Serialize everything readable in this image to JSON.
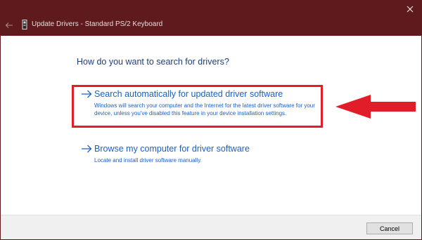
{
  "window": {
    "title": "Update Drivers - Standard PS/2 Keyboard",
    "titlebar_color": "#5e1a1c",
    "close_icon": "close-icon",
    "back_icon": "back-arrow-icon",
    "device_icon": "keyboard-device-icon"
  },
  "main": {
    "heading": "How do you want to search for drivers?",
    "options": [
      {
        "title": "Search automatically for updated driver software",
        "description": "Windows will search your computer and the Internet for the latest driver software for your device, unless you've disabled this feature in your device installation settings.",
        "icon": "right-arrow-icon",
        "highlighted": true
      },
      {
        "title": "Browse my computer for driver software",
        "description": "Locate and install driver software manually.",
        "icon": "right-arrow-icon",
        "highlighted": false
      }
    ],
    "link_color": "#1a5fc8",
    "heading_color": "#1f3f7a"
  },
  "annotation": {
    "highlight_color": "#e21d2a",
    "arrow_icon": "pointer-arrow-icon"
  },
  "footer": {
    "cancel_label": "Cancel"
  }
}
